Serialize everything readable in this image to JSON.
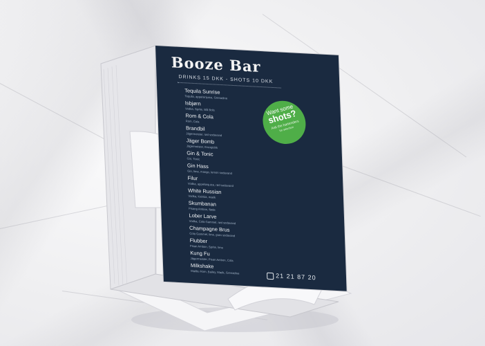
{
  "menu": {
    "title": "Booze Bar",
    "subtitle": "DRINKS 15 DKK - SHOTS 10 DKK",
    "items": [
      {
        "name": "Tequila Sunrise",
        "desc": "Tequila, appelsinjuice, Grenadine"
      },
      {
        "name": "Isbjørn",
        "desc": "Vodka, Sprite, Blå Bols"
      },
      {
        "name": "Rom & Cola",
        "desc": "Rom, Cola"
      },
      {
        "name": "Brandbil",
        "desc": "Jägermeister, rød sodavand"
      },
      {
        "name": "Jäger Bomb",
        "desc": "Jägermeister, Energidrik"
      },
      {
        "name": "Gin & Tonic",
        "desc": "Gin, Tonic"
      },
      {
        "name": "Gin Hass",
        "desc": "Gin, lime, mango, lemon sodavand"
      },
      {
        "name": "Filur",
        "desc": "Vodka, appelsinjuice, rød sodavand"
      },
      {
        "name": "White Russian",
        "desc": "Vodka, Kahlúa, mælk"
      },
      {
        "name": "Skumbanan",
        "desc": "Pisang Ambon, fløde"
      },
      {
        "name": "Lober Larve",
        "desc": "Vodka, Cola Gammel, rød sodavand"
      },
      {
        "name": "Champagne Brus",
        "desc": "Cola Gammel, lime, grøn sodavand"
      },
      {
        "name": "Flubber",
        "desc": "Pisan Ambon, Sprite, lime"
      },
      {
        "name": "Kung Fu",
        "desc": "Jägermeister, Pisan Ambon, Cola"
      },
      {
        "name": "Milkshake",
        "desc": "Malibu Rom, Bailey, Mælk, Grenadine"
      }
    ],
    "badge": {
      "line1": "Want some",
      "line2": "shots?",
      "line3": "Ask the bartenders",
      "line4": "for selection"
    },
    "phone": "21 21 87 20",
    "colors": {
      "panel": "#1a2a40",
      "badge": "#4fae48",
      "background": "#ececef"
    }
  }
}
